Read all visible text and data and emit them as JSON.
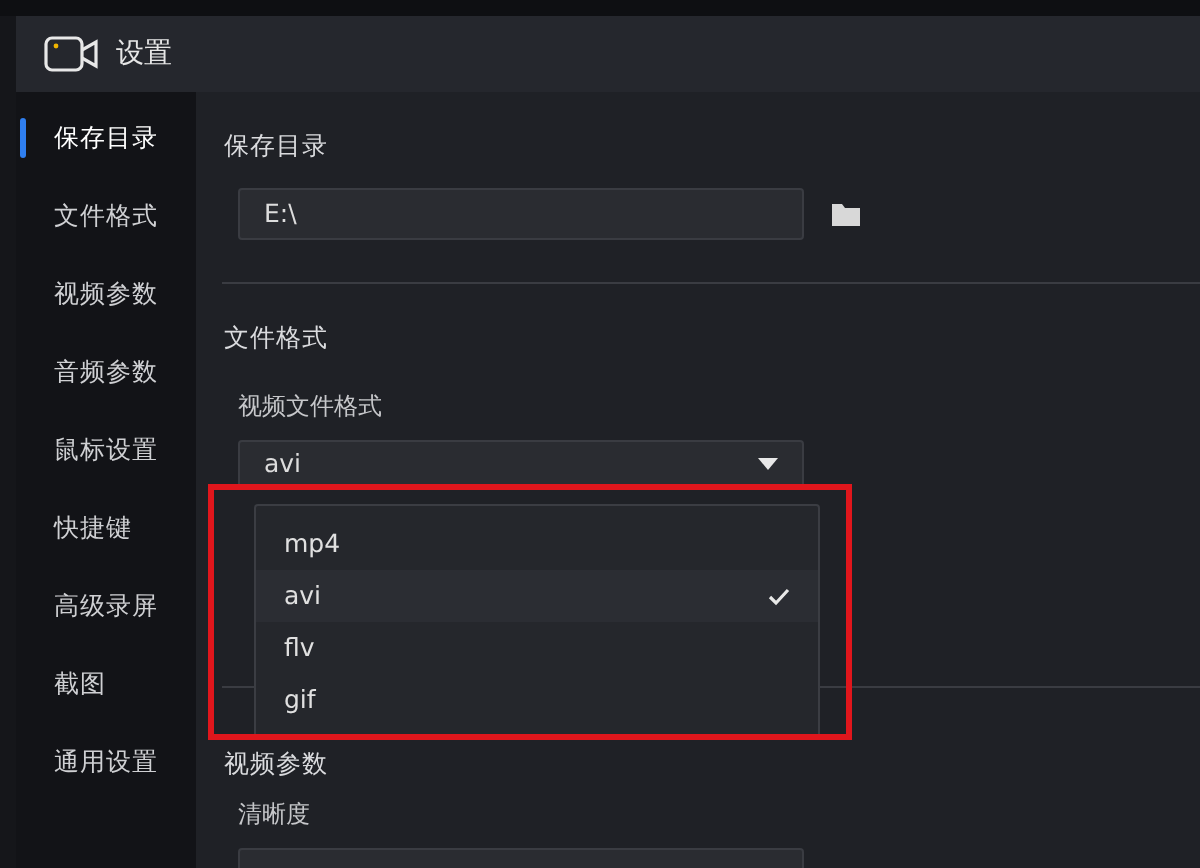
{
  "window": {
    "title": "设置"
  },
  "sidebar": {
    "items": [
      {
        "label": "保存目录",
        "selected": true
      },
      {
        "label": "文件格式",
        "selected": false
      },
      {
        "label": "视频参数",
        "selected": false
      },
      {
        "label": "音频参数",
        "selected": false
      },
      {
        "label": "鼠标设置",
        "selected": false
      },
      {
        "label": "快捷键",
        "selected": false
      },
      {
        "label": "高级录屏",
        "selected": false
      },
      {
        "label": "截图",
        "selected": false
      },
      {
        "label": "通用设置",
        "selected": false
      }
    ]
  },
  "save_dir": {
    "heading": "保存目录",
    "value": "E:\\"
  },
  "file_format": {
    "heading": "文件格式",
    "label": "视频文件格式",
    "value": "avi",
    "dropdown": {
      "expanded": true,
      "options": [
        {
          "label": "mp4",
          "selected": false
        },
        {
          "label": "avi",
          "selected": true
        },
        {
          "label": "flv",
          "selected": false
        },
        {
          "label": "gif",
          "selected": false
        }
      ]
    }
  },
  "video_params": {
    "heading": "视频参数",
    "label": "清晰度"
  }
}
